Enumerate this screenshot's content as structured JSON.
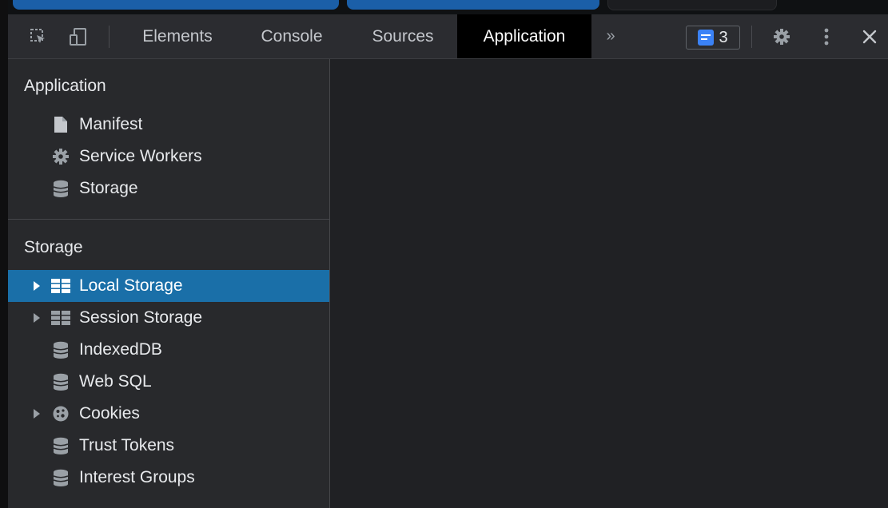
{
  "toolbar": {
    "tabs": [
      {
        "label": "Elements"
      },
      {
        "label": "Console"
      },
      {
        "label": "Sources"
      },
      {
        "label": "Application"
      }
    ],
    "active_tab": "Application",
    "more_tabs_label": "»",
    "issues_count": "3",
    "icons": [
      "inspect-element-icon",
      "device-toolbar-icon",
      "issues-icon",
      "gear-icon",
      "kebab-menu-icon",
      "close-icon"
    ]
  },
  "sidebar": {
    "sections": [
      {
        "title": "Application",
        "items": [
          {
            "label": "Manifest",
            "icon": "file-icon"
          },
          {
            "label": "Service Workers",
            "icon": "gear-icon"
          },
          {
            "label": "Storage",
            "icon": "database-icon"
          }
        ]
      },
      {
        "title": "Storage",
        "items": [
          {
            "label": "Local Storage",
            "icon": "grid-icon",
            "expandable": true,
            "selected": true
          },
          {
            "label": "Session Storage",
            "icon": "grid-icon",
            "expandable": true
          },
          {
            "label": "IndexedDB",
            "icon": "database-icon"
          },
          {
            "label": "Web SQL",
            "icon": "database-icon"
          },
          {
            "label": "Cookies",
            "icon": "cookie-icon",
            "expandable": true
          },
          {
            "label": "Trust Tokens",
            "icon": "database-icon"
          },
          {
            "label": "Interest Groups",
            "icon": "database-icon"
          }
        ]
      }
    ]
  },
  "colors": {
    "selection": "#1a6fa8",
    "active_tab_bg": "#000000",
    "badge_blue": "#3b82f6"
  }
}
